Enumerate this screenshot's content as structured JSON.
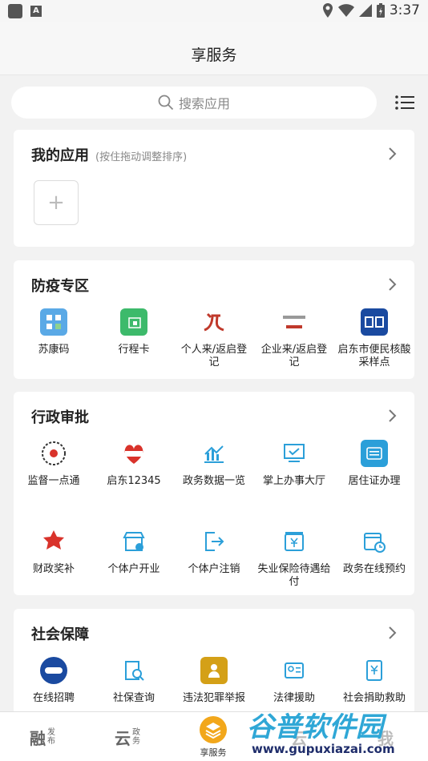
{
  "status_bar": {
    "time": "3:37",
    "badge_letter": "A"
  },
  "header": {
    "title": "享服务"
  },
  "search": {
    "placeholder": "搜索应用"
  },
  "my_apps": {
    "title": "我的应用",
    "hint": "(按住拖动调整排序)",
    "add_symbol": "+"
  },
  "sections": [
    {
      "title": "防疫专区",
      "items": [
        {
          "label": "苏康码",
          "icon": "sukang-qr-icon",
          "color": "#5aa9e6"
        },
        {
          "label": "行程卡",
          "icon": "travel-card-icon",
          "color": "#3dba6b"
        },
        {
          "label": "个人来/返启登记",
          "icon": "return-register-icon",
          "color": "#c0392b"
        },
        {
          "label": "企业来/返启登记",
          "icon": "enterprise-register-icon",
          "color": "#c0392b"
        },
        {
          "label": "启东市便民核酸采样点",
          "icon": "notice-icon",
          "color": "#1a4aa0"
        }
      ]
    },
    {
      "title": "行政审批",
      "items": [
        {
          "label": "监督一点通",
          "icon": "supervision-qr-icon",
          "color": "#333333"
        },
        {
          "label": "启东12345",
          "icon": "hotline-12345-icon",
          "color": "#d9332b"
        },
        {
          "label": "政务数据一览",
          "icon": "data-chart-icon",
          "color": "#2b9fd9"
        },
        {
          "label": "掌上办事大厅",
          "icon": "monitor-check-icon",
          "color": "#2b9fd9"
        },
        {
          "label": "居住证办理",
          "icon": "residence-card-icon",
          "color": "#2b9fd9"
        },
        {
          "label": "财政奖补",
          "icon": "finance-award-icon",
          "color": "#d9332b"
        },
        {
          "label": "个体户开业",
          "icon": "shop-open-icon",
          "color": "#2b9fd9"
        },
        {
          "label": "个体户注销",
          "icon": "logout-arrow-icon",
          "color": "#2b9fd9"
        },
        {
          "label": "失业保险待遇给付",
          "icon": "insurance-yen-icon",
          "color": "#2b9fd9"
        },
        {
          "label": "政务在线预约",
          "icon": "calendar-clock-icon",
          "color": "#2b9fd9"
        }
      ]
    },
    {
      "title": "社会保障",
      "items": [
        {
          "label": "在线招聘",
          "icon": "recruit-icon",
          "color": "#1a4aa0"
        },
        {
          "label": "社保查询",
          "icon": "social-security-search-icon",
          "color": "#2b9fd9"
        },
        {
          "label": "违法犯罪举报",
          "icon": "report-icon",
          "color": "#d4a017"
        },
        {
          "label": "法律援助",
          "icon": "legal-aid-icon",
          "color": "#2b9fd9"
        },
        {
          "label": "社会捐助救助",
          "icon": "donation-icon",
          "color": "#2b9fd9"
        }
      ]
    }
  ],
  "tabs": [
    {
      "name": "融",
      "sub1": "发",
      "sub2": "布"
    },
    {
      "name": "云",
      "sub1": "政",
      "sub2": "务"
    },
    {
      "name": "享服务",
      "active_color": "#f2a71b"
    },
    {
      "name": "云",
      "sub1": "",
      "sub2": ""
    },
    {
      "name": "我",
      "sub1": "",
      "sub2": ""
    }
  ],
  "watermark": {
    "brand": "谷普软件园",
    "url": "www.gupuxiazai.com"
  }
}
